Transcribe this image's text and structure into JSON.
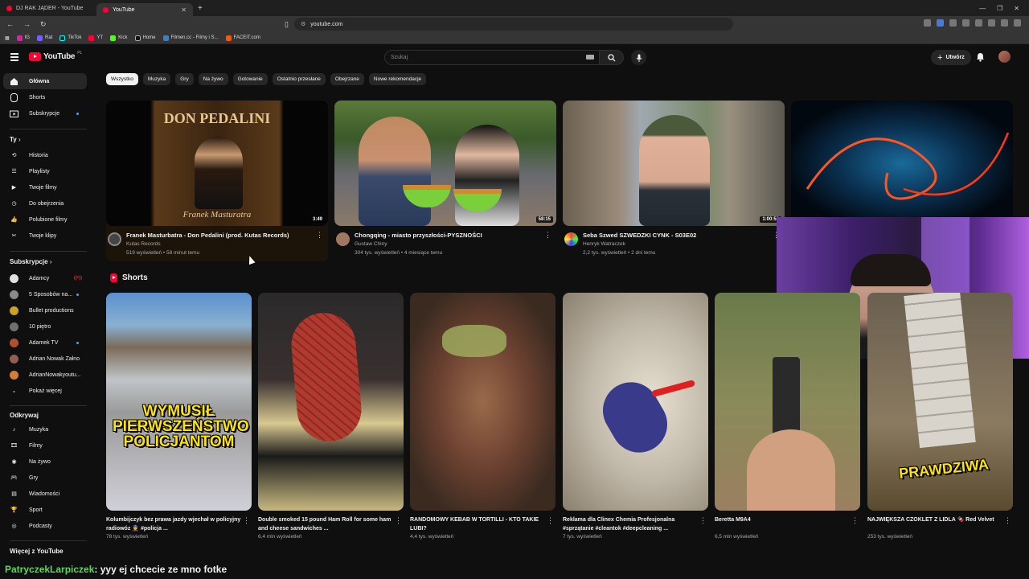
{
  "browser": {
    "tabs": [
      {
        "label": "DJ RAK JĄDER - YouTube",
        "active": false
      },
      {
        "label": "YouTube",
        "active": true
      }
    ],
    "url": "youtube.com",
    "bookmarks": [
      "IG",
      "Rat",
      "TikTok",
      "YT",
      "Kick",
      "Home",
      "Filmen.cc - Filmy i S...",
      "FACEIT.com"
    ]
  },
  "header": {
    "logo_text": "YouTube",
    "country": "PL",
    "search_placeholder": "Szukaj",
    "create_label": "Utwórz"
  },
  "sidebar": {
    "main": [
      {
        "label": "Główna",
        "icon": "home-icon",
        "active": true
      },
      {
        "label": "Shorts",
        "icon": "shorts-icon"
      },
      {
        "label": "Subskrypcje",
        "icon": "subscriptions-icon",
        "dot": true
      }
    ],
    "you_heading": "Ty",
    "you": [
      {
        "label": "Historia",
        "icon": "history-icon"
      },
      {
        "label": "Playlisty",
        "icon": "playlist-icon"
      },
      {
        "label": "Twoje filmy",
        "icon": "video-icon"
      },
      {
        "label": "Do obejrzenia",
        "icon": "clock-icon"
      },
      {
        "label": "Polubione filmy",
        "icon": "thumbs-up-icon"
      },
      {
        "label": "Twoje klipy",
        "icon": "scissors-icon"
      }
    ],
    "subs_heading": "Subskrypcje",
    "subs": [
      {
        "label": "Adamcy",
        "color": "#e0e0e0",
        "live": true
      },
      {
        "label": "5 Sposobów na...",
        "color": "#8a8a8a",
        "dot": true
      },
      {
        "label": "Bullet productions",
        "color": "#c9a227"
      },
      {
        "label": "10 piętro",
        "color": "#707070"
      },
      {
        "label": "Adamek TV",
        "color": "#b05030",
        "dot": true
      },
      {
        "label": "Adrian Nowak Załno",
        "color": "#906050"
      },
      {
        "label": "AdrianNowakyoutu...",
        "color": "#d08030"
      }
    ],
    "show_more": "Pokaż więcej",
    "explore_heading": "Odkrywaj",
    "explore": [
      {
        "label": "Muzyka",
        "icon": "music-icon"
      },
      {
        "label": "Filmy",
        "icon": "film-icon"
      },
      {
        "label": "Na żywo",
        "icon": "live-icon"
      },
      {
        "label": "Gry",
        "icon": "gamepad-icon"
      },
      {
        "label": "Wiadomości",
        "icon": "news-icon"
      },
      {
        "label": "Sport",
        "icon": "trophy-icon"
      },
      {
        "label": "Podcasty",
        "icon": "podcast-icon"
      }
    ],
    "more_heading": "Więcej z YouTube"
  },
  "chips": [
    "Wszystko",
    "Muzyka",
    "Gry",
    "Na żywo",
    "Gotowanie",
    "Ostatnio przesłane",
    "Obejrzane",
    "Nowe rekomendacje"
  ],
  "videos": [
    {
      "title": "Franek Masturbatra - Don Pedalini (prod. Kutas Records)",
      "channel": "Kutas Records",
      "stats": "519 wyświetleń • 58 minut temu",
      "duration": "3:49",
      "thumb_title": "DON PEDALINI",
      "thumb_sub": "Franek Masturatra"
    },
    {
      "title": "Chongqing - miasto przyszłości-PYSZNOŚCI",
      "channel": "Gustaw Chiny",
      "stats": "304 tys. wyświetleń • 4 miesiące temu",
      "duration": "58:15"
    },
    {
      "title": "Seba Szwed SZWEDZKI CYNK - S03E02",
      "channel": "Henryk Watraczek",
      "stats": "2,2 tys. wyświetleń • 2 dni temu",
      "duration": "1:00:53"
    },
    {
      "title": "",
      "channel": "",
      "stats": "",
      "duration": ""
    }
  ],
  "shorts_heading": "Shorts",
  "shorts": [
    {
      "title": "Kolumbijczyk bez prawa jazdy wjechał w policyjny radiowóz 👮 #policja ...",
      "views": "78 tys. wyświetleń",
      "overlay": "WYMUSIŁ PIERWSZEŃSTWO POLICJANTOM"
    },
    {
      "title": "Double smoked 15 pound Ham Roll for some ham and cheese sandwiches ...",
      "views": "6,4 mln wyświetleń"
    },
    {
      "title": "RANDOMOWY KEBAB W TORTILLI - KTO TAKIE LUBI?",
      "views": "4,4 tys. wyświetleń"
    },
    {
      "title": "Reklama dla Clinex Chemia Profesjonalna #sprzątanie #cleantok #deepcleaning ...",
      "views": "7 tys. wyświetleń"
    },
    {
      "title": "Beretta M9A4",
      "views": "6,5 mln wyświetleń"
    },
    {
      "title": "NAJWIĘKSZA CZOKLET Z LIDLA 🍫 Red Velvet",
      "views": "253 tys. wyświetleń",
      "overlay": "PRAWDZIWA"
    }
  ],
  "chat": {
    "user": "PatryczekLarpiczek",
    "message": ": yyy ej chcecie ze mno fotke"
  }
}
